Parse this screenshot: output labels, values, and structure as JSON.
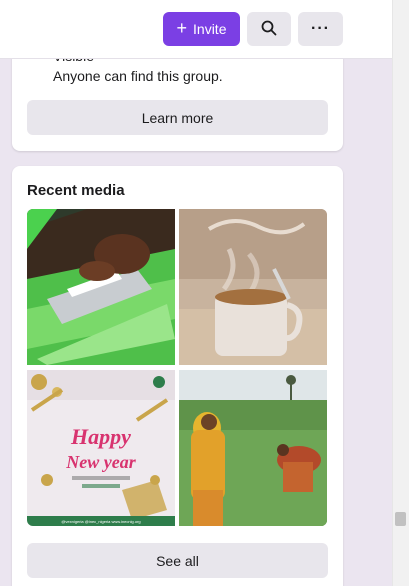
{
  "toolbar": {
    "invite_label": "Invite",
    "plus_glyph": "+",
    "more_glyph": "···",
    "invite_icon": "plus-icon",
    "search_icon": "search-icon",
    "more_icon": "more-horizontal-icon"
  },
  "privacy": {
    "visible_label": "Visible",
    "visible_desc": "Anyone can find this group.",
    "learn_more_label": "Learn more"
  },
  "recent_media": {
    "title": "Recent media",
    "see_all_label": "See all",
    "thumbnails": [
      {
        "name": "ballot-box-photo"
      },
      {
        "name": "coffee-mug-photo"
      },
      {
        "name": "happy-new-year-flyer"
      },
      {
        "name": "farm-field-photo"
      }
    ],
    "flyer_text": {
      "line1": "Happy",
      "line2": "New year",
      "footer": "@vexnigeria   @inec_nigeria   www.inecnig.org"
    }
  },
  "colors": {
    "accent": "#7b3fe4",
    "button_gray": "#e8e6ec",
    "page_bg": "#ebe5f0"
  }
}
